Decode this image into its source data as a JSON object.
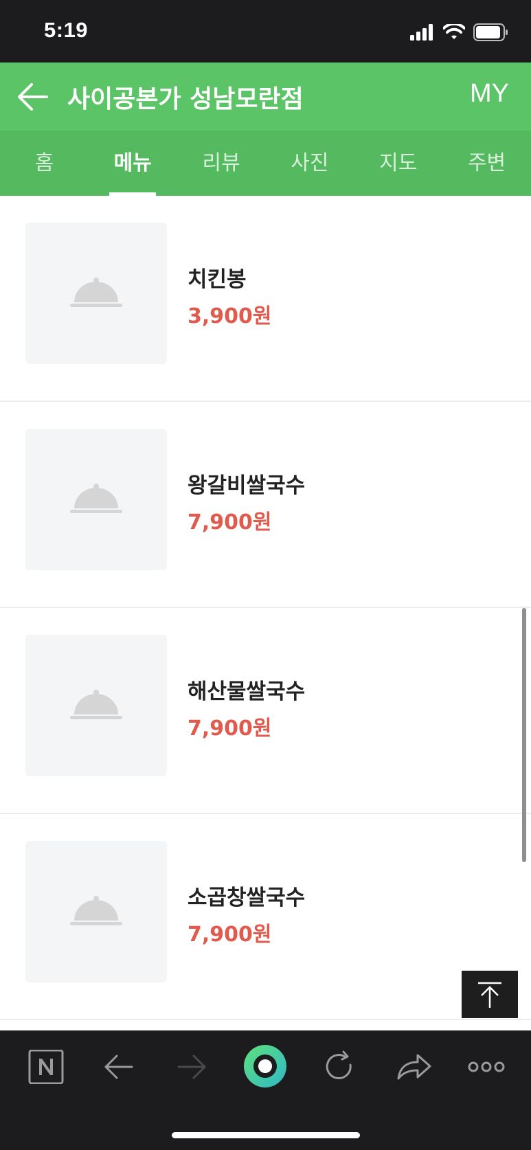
{
  "status_bar": {
    "time": "5:19",
    "icons": [
      "cellular-signal-icon",
      "wifi-icon",
      "battery-icon"
    ]
  },
  "header": {
    "back_icon": "arrow-left-icon",
    "title": "사이공본가 성남모란점",
    "my_label": "MY"
  },
  "tabs": [
    {
      "label": "홈",
      "active": false
    },
    {
      "label": "메뉴",
      "active": true
    },
    {
      "label": "리뷰",
      "active": false
    },
    {
      "label": "사진",
      "active": false
    },
    {
      "label": "지도",
      "active": false
    },
    {
      "label": "주변",
      "active": false
    }
  ],
  "menu_items": [
    {
      "name": "치킨봉",
      "price": "3,900원",
      "thumb_icon": "food-cloche-icon"
    },
    {
      "name": "왕갈비쌀국수",
      "price": "7,900원",
      "thumb_icon": "food-cloche-icon"
    },
    {
      "name": "해산물쌀국수",
      "price": "7,900원",
      "thumb_icon": "food-cloche-icon"
    },
    {
      "name": "소곱창쌀국수",
      "price": "7,900원",
      "thumb_icon": "food-cloche-icon"
    }
  ],
  "scroll_top_icon": "scroll-to-top-icon",
  "bottom_bar": {
    "items": [
      "naver-n-icon",
      "back-arrow-icon",
      "forward-arrow-icon",
      "green-dot-home-icon",
      "refresh-icon",
      "share-icon",
      "more-dots-icon"
    ]
  },
  "colors": {
    "header_green": "#5bc466",
    "tabs_green": "#54b95f",
    "price_red": "#e05a4e",
    "status_bar": "#1c1c1e"
  }
}
